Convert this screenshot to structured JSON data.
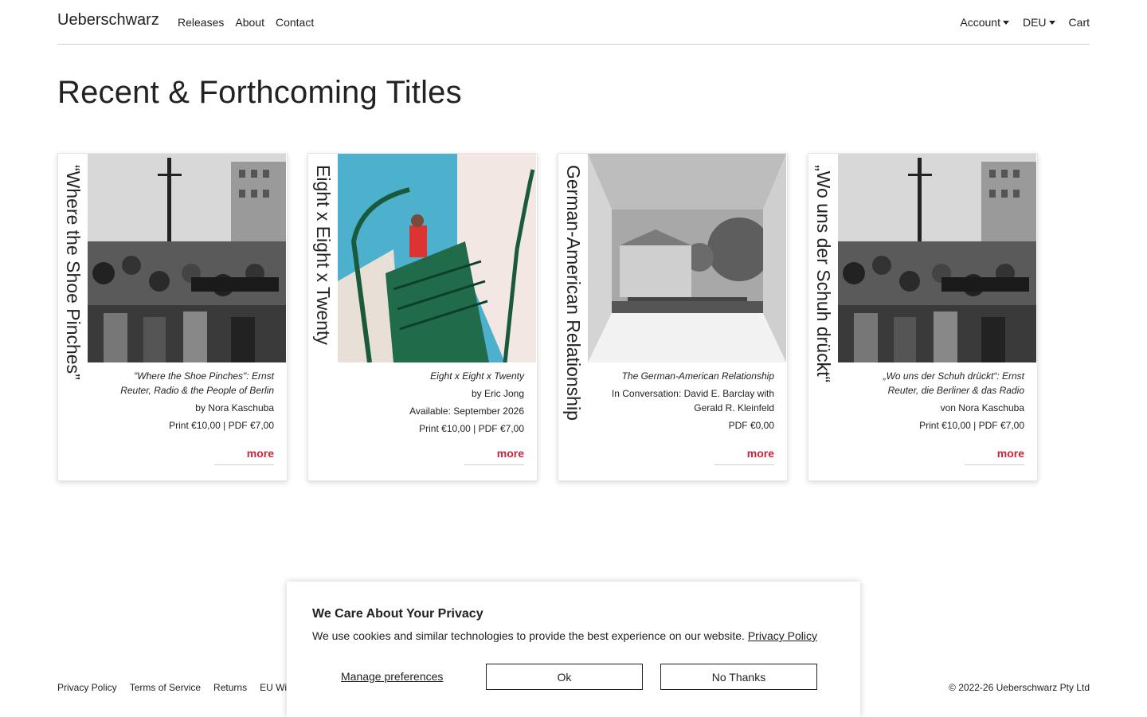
{
  "nav": {
    "brand": "Ueberschwarz",
    "links": [
      "Releases",
      "About",
      "Contact"
    ],
    "right": {
      "account": "Account",
      "language": "DEU",
      "cart": "Cart"
    }
  },
  "page_title": "Recent & Forthcoming Titles",
  "cards": [
    {
      "vertical_title": "“Where the Shoe Pinches”",
      "cover": "crowd-photo-bw",
      "title": "\"Where the Shoe Pinches\": Ernst Reuter, Radio & the People of Berlin",
      "line2": "by Nora Kaschuba",
      "line3": "Print €10,00 | PDF €7,00",
      "line4": "",
      "more": "more"
    },
    {
      "vertical_title": "Eight x Eight x Twenty",
      "cover": "ship-stairs-color",
      "title": "Eight x Eight x Twenty",
      "line2": "by Eric Jong",
      "line3": "Available: September 2026",
      "line4": "Print €10,00 | PDF €7,00",
      "more": "more"
    },
    {
      "vertical_title": "German-American Relationship",
      "cover": "skylight-bw",
      "title": "The German-American Relationship",
      "line2": "In Conversation: David E. Barclay with Gerald R. Kleinfeld",
      "line3": "PDF €0,00",
      "line4": "",
      "more": "more"
    },
    {
      "vertical_title": "„Wo uns der Schuh drückt“",
      "cover": "crowd-photo-bw",
      "title": "„Wo uns der Schuh drückt“: Ernst Reuter, die Berliner & das Radio",
      "line2": "von Nora Kaschuba",
      "line3": "Print €10,00 | PDF €7,00",
      "line4": "",
      "more": "more"
    }
  ],
  "footer": {
    "links": [
      "Privacy Policy",
      "Terms of Service",
      "Returns",
      "EU Wit"
    ],
    "copyright": "© 2022-26 Ueberschwarz Pty Ltd"
  },
  "cookie": {
    "heading": "We Care About Your Privacy",
    "text": "We use cookies and similar technologies to provide the best experience on our website.",
    "privacy_link": "Privacy Policy",
    "manage": "Manage preferences",
    "ok": "Ok",
    "no": "No Thanks"
  },
  "colors": {
    "accent": "#c8243c",
    "text": "#222222"
  },
  "icons": {
    "dropdown": "caret-down-icon"
  }
}
